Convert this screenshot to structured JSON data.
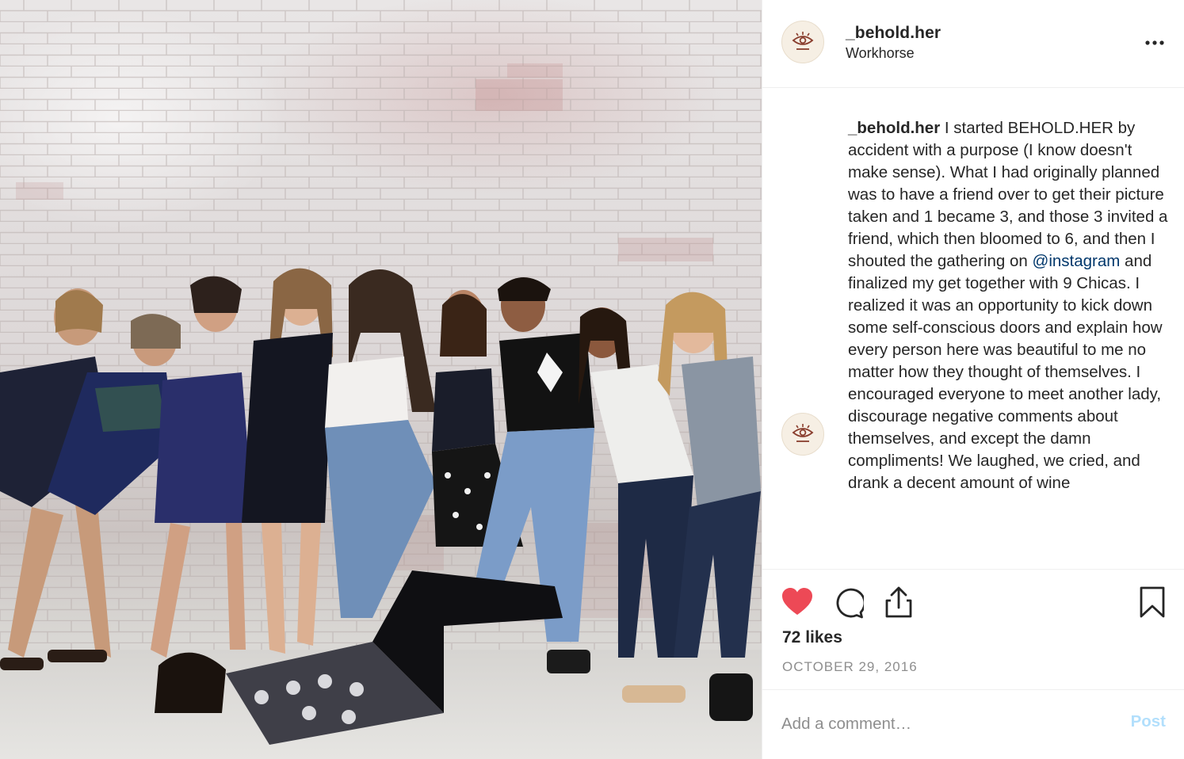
{
  "post": {
    "photo": {
      "alt": "",
      "people_count": 10
    },
    "header": {
      "username": "_behold.her",
      "location": "Workhorse",
      "avatar_icon": "eye-logo-icon",
      "more_icon": "more-options-icon"
    },
    "caption": {
      "username": "_behold.her",
      "text_before_mention": " I started BEHOLD.HER by accident with a purpose (I know doesn't make sense). What I had originally planned was to have a friend over to get their picture taken and 1 became 3, and those 3 invited a friend, which then bloomed to 6, and then I shouted the gathering on ",
      "mention": "@instagram",
      "text_after_mention": " and finalized my get together with 9 Chicas. I realized it was an opportunity to kick down some self-conscious doors and explain how every person here was beautiful to me no matter how they thought of themselves. I encouraged everyone to meet another lady, discourage negative comments about themselves, and except the damn compliments! We laughed, we cried, and drank a decent amount of wine"
    },
    "actions": {
      "liked": true,
      "like_color": "#ed4956",
      "icons": [
        "heart-icon",
        "comment-icon",
        "share-icon",
        "bookmark-icon"
      ]
    },
    "likes": "72 likes",
    "date": "OCTOBER 29, 2016",
    "comment_box": {
      "placeholder": "Add a comment…",
      "post_label": "Post",
      "post_color": "#b2dffc"
    },
    "colors": {
      "text": "#262626",
      "secondary": "#8e8e8e",
      "mention": "#00376b",
      "divider": "#efefef"
    }
  }
}
